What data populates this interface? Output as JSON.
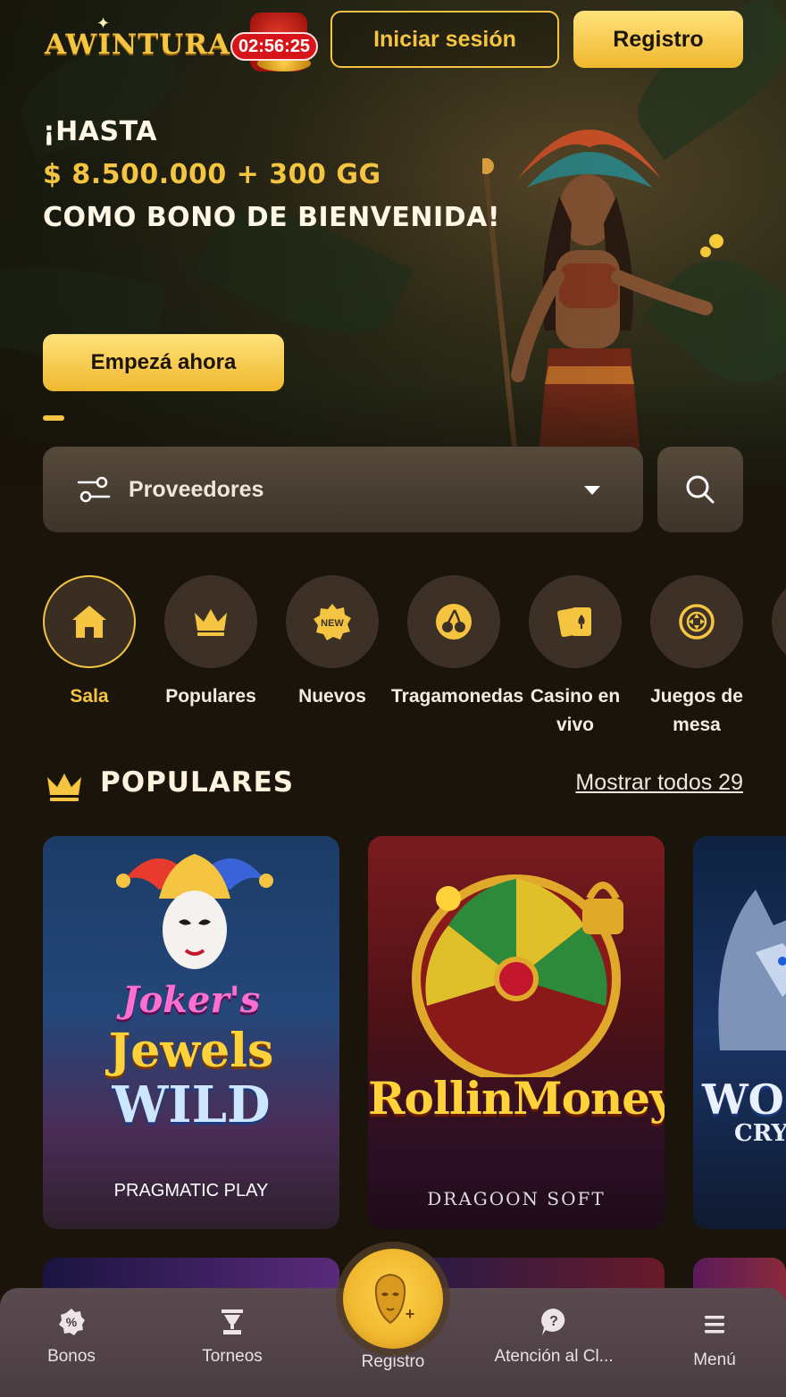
{
  "header": {
    "logo_text": "AWINTURA",
    "timer": "02:56:25",
    "login_label": "Iniciar sesión",
    "register_label": "Registro"
  },
  "hero": {
    "line1": "¡HASTA",
    "line2": "$ 8.500.000 + 300 GG",
    "line3": "COMO BONO DE BIENVENIDA!",
    "cta_label": "Empezá ahora"
  },
  "filters": {
    "providers_label": "Proveedores"
  },
  "categories": [
    {
      "label": "Sala",
      "icon": "home-icon",
      "active": true
    },
    {
      "label": "Populares",
      "icon": "crown-icon",
      "active": false
    },
    {
      "label": "Nuevos",
      "icon": "new-badge-icon",
      "active": false
    },
    {
      "label": "Tragamonedas",
      "icon": "cherry-icon",
      "active": false
    },
    {
      "label": "Casino en vivo",
      "icon": "cards-icon",
      "active": false
    },
    {
      "label": "Juegos de mesa",
      "icon": "table-games-icon",
      "active": false
    }
  ],
  "popular": {
    "title": "POPULARES",
    "show_all": "Mostrar todos 29",
    "games": [
      {
        "title_parts": [
          "Joker's",
          "Jewels",
          "WILD"
        ],
        "provider": "PRAGMATIC PLAY"
      },
      {
        "title_parts": [
          "RollinMoney"
        ],
        "provider": "DRAGOON SOFT"
      },
      {
        "title_parts": [
          "WO",
          "CRY"
        ],
        "provider": ""
      }
    ]
  },
  "bottom_nav": {
    "items": [
      {
        "label": "Bonos",
        "icon": "bonus-icon"
      },
      {
        "label": "Torneos",
        "icon": "trophy-icon"
      },
      {
        "label": "Registro",
        "icon": "mask-icon"
      },
      {
        "label": "Atención al Cl...",
        "icon": "help-icon"
      },
      {
        "label": "Menú",
        "icon": "menu-icon"
      }
    ]
  },
  "colors": {
    "accent": "#f5c542",
    "background": "#1a140b",
    "surface": "#3d3127",
    "timer_bg": "#d7141a"
  }
}
